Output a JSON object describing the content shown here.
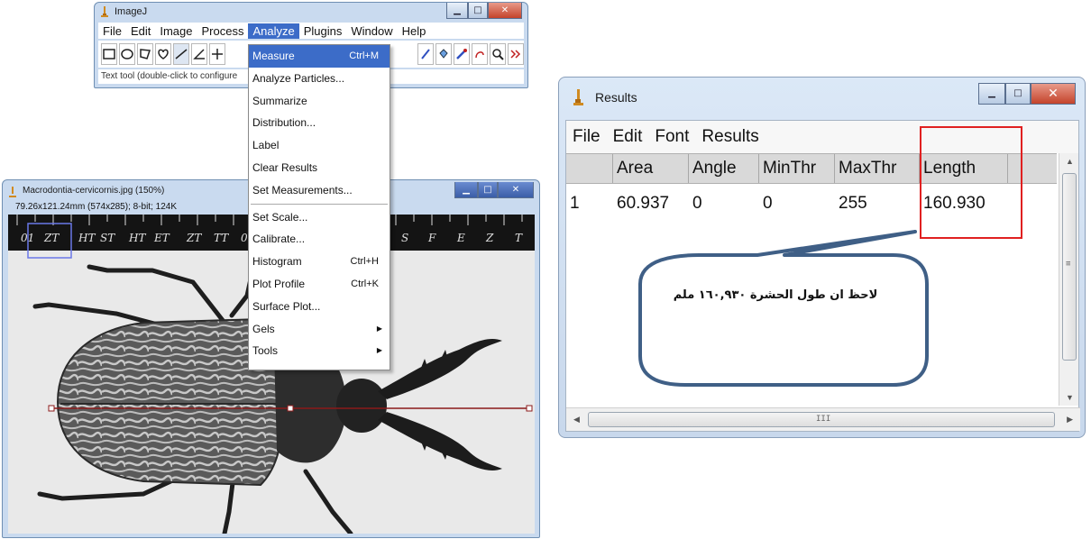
{
  "imagej": {
    "title": "ImageJ",
    "menus": [
      "File",
      "Edit",
      "Image",
      "Process",
      "Analyze",
      "Plugins",
      "Window",
      "Help"
    ],
    "active_menu": "Analyze",
    "status": "Text tool (double-click to configure"
  },
  "image_window": {
    "title": "Macrodontia-cervicornis.jpg (150%)",
    "info": "79.26x121.24mm (574x285); 8-bit; 124K"
  },
  "analyze_menu": {
    "items": [
      {
        "label": "Measure",
        "shortcut": "Ctrl+M"
      },
      {
        "label": "Analyze Particles..."
      },
      {
        "label": "Summarize"
      },
      {
        "label": "Distribution..."
      },
      {
        "label": "Label"
      },
      {
        "label": "Clear Results"
      },
      {
        "label": "Set Measurements..."
      },
      {
        "label": "Set Scale..."
      },
      {
        "label": "Calibrate..."
      },
      {
        "label": "Histogram",
        "shortcut": "Ctrl+H"
      },
      {
        "label": "Plot Profile",
        "shortcut": "Ctrl+K"
      },
      {
        "label": "Surface Plot..."
      },
      {
        "label": "Gels"
      },
      {
        "label": "Tools"
      }
    ]
  },
  "results": {
    "title": "Results",
    "menus": [
      "File",
      "Edit",
      "Font",
      "Results"
    ],
    "columns": [
      "",
      "Area",
      "Angle",
      "MinThr",
      "MaxThr",
      "Length"
    ],
    "row": [
      "1",
      "60.937",
      "0",
      "0",
      "255",
      "160.930"
    ],
    "scroll_grip": "≡",
    "hscroll_grip": "III"
  },
  "annotation": {
    "text": "لاحظ ان طول الحشرة ١٦٠,٩٣٠ ملم"
  },
  "ruler": {
    "numbers": [
      "01",
      "ZT",
      "HT",
      "ST",
      "HT",
      "ET",
      "ZT",
      "TT",
      "0",
      "S",
      "F",
      "E",
      "Z",
      "T"
    ]
  },
  "colors": {
    "menu_highlight": "#3c6cc8",
    "highlight_box": "#e02020",
    "measure_line": "#8b1a1a"
  }
}
